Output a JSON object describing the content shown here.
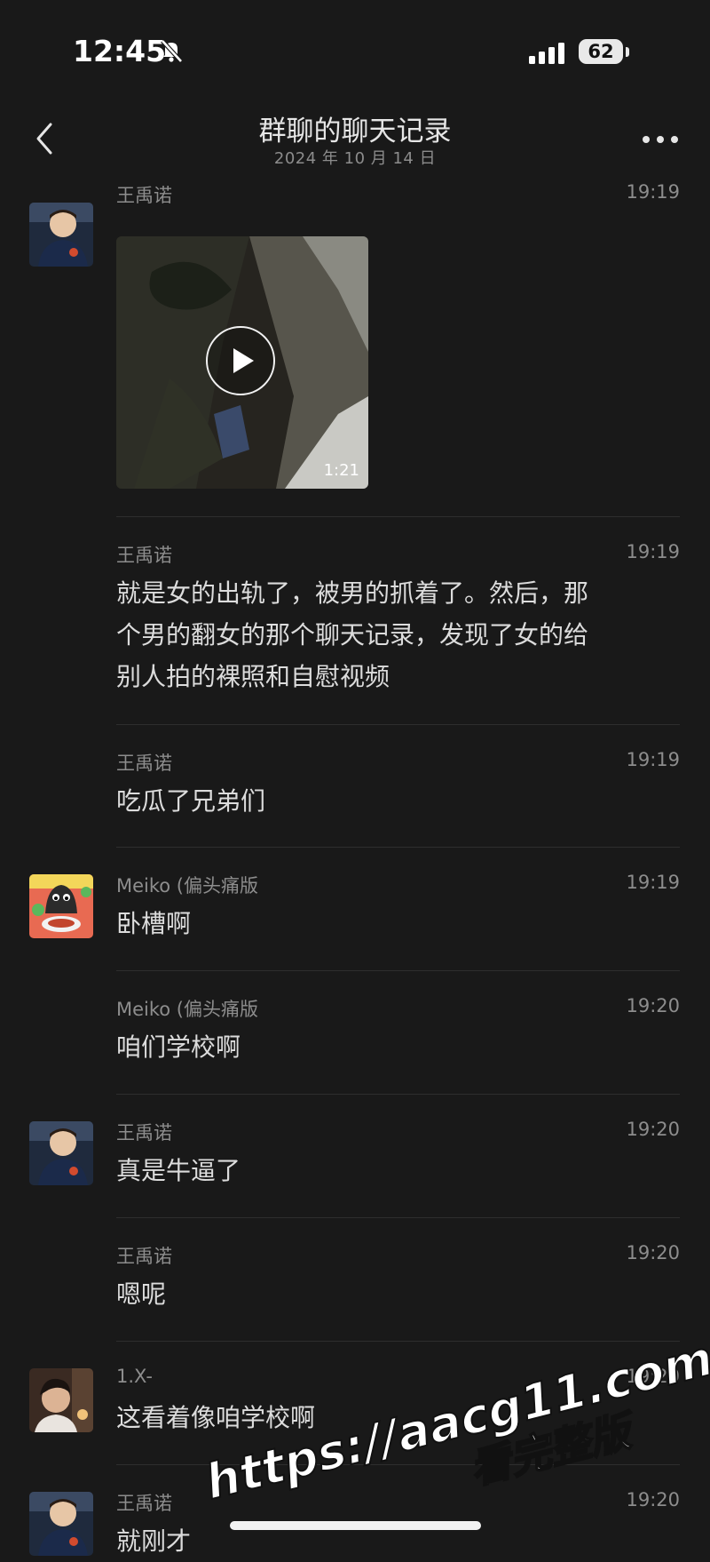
{
  "status": {
    "time": "12:45",
    "battery": "62"
  },
  "header": {
    "title": "群聊的聊天记录",
    "subtitle": "2024 年 10 月 14 日"
  },
  "messages": [
    {
      "sender": "王禹诺",
      "time": "19:19",
      "video_duration": "1:21"
    },
    {
      "sender": "王禹诺",
      "time": "19:19",
      "text_lines": [
        "就是女的出轨了，被男的抓着了。然后，那",
        "个男的翻女的那个聊天记录，发现了女的给",
        "别人拍的裸照和自慰视频"
      ]
    },
    {
      "sender": "王禹诺",
      "time": "19:19",
      "text": "吃瓜了兄弟们"
    },
    {
      "sender": "Meiko (偏头痛版",
      "time": "19:19",
      "text": "卧槽啊"
    },
    {
      "sender": "Meiko (偏头痛版",
      "time": "19:20",
      "text": "咱们学校啊"
    },
    {
      "sender": "王禹诺",
      "time": "19:20",
      "text": "真是牛逼了"
    },
    {
      "sender": "王禹诺",
      "time": "19:20",
      "text": "嗯呢"
    },
    {
      "sender": "1.X-",
      "time": "19:20",
      "text": "这看着像咱学校啊"
    },
    {
      "sender": "王禹诺",
      "time": "19:20",
      "text": "就刚才"
    }
  ],
  "watermark": {
    "line1": "https://aacg11.com",
    "line2": "看完整版"
  },
  "icons": [
    "bell-slash-icon",
    "signal-icon",
    "battery-icon",
    "back-chevron-icon",
    "more-icon",
    "play-icon"
  ]
}
